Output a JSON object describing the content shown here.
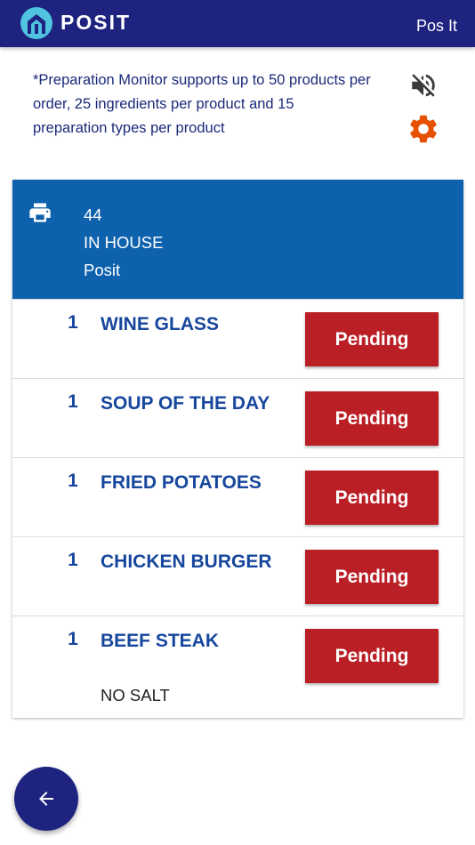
{
  "app": {
    "logo_text": "POSIT",
    "user_label": "Pos It",
    "brand_color": "#1d237f",
    "icons": {
      "logo": "posit-logo-icon"
    }
  },
  "notice": {
    "text": "*Preparation Monitor supports up to 50 products per order, 25 ingredients per product and 15 preparation types per product"
  },
  "toolbar": {
    "mute_icon": "volume-off-icon",
    "settings_icon": "gear-icon",
    "settings_color": "#e65100"
  },
  "order": {
    "number": "44",
    "type": "IN HOUSE",
    "source": "Posit",
    "header_color": "#0e62ad",
    "print_icon": "printer-icon",
    "items": [
      {
        "qty": "1",
        "name": "WINE GLASS",
        "status": "Pending",
        "note": ""
      },
      {
        "qty": "1",
        "name": "SOUP OF THE DAY",
        "status": "Pending",
        "note": ""
      },
      {
        "qty": "1",
        "name": "FRIED POTATOES",
        "status": "Pending",
        "note": ""
      },
      {
        "qty": "1",
        "name": "CHICKEN BURGER",
        "status": "Pending",
        "note": ""
      },
      {
        "qty": "1",
        "name": "BEEF STEAK",
        "status": "Pending",
        "note": "NO SALT"
      }
    ],
    "status_color": "#ba1f26"
  },
  "nav": {
    "back_icon": "arrow-left-icon"
  }
}
